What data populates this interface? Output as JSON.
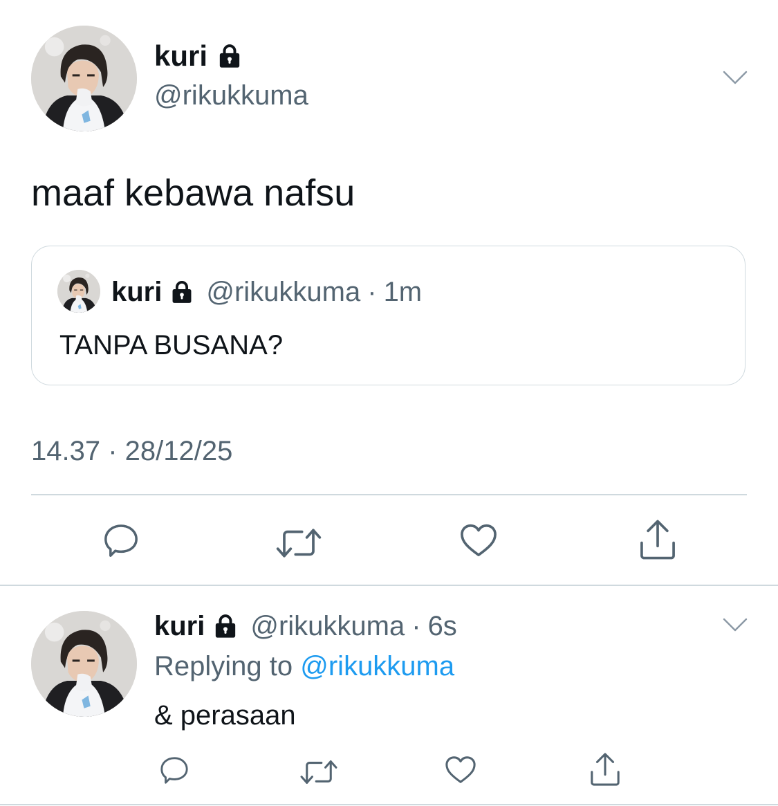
{
  "main_tweet": {
    "name": "kuri",
    "handle": "@rikukkuma",
    "text": "maaf kebawa nafsu",
    "timestamp": "14.37 · 28/12/25",
    "icons": {
      "lock": "lock-icon",
      "more": "chevron-down-icon",
      "reply": "reply-icon",
      "retweet": "retweet-icon",
      "like": "heart-icon",
      "share": "share-icon"
    }
  },
  "quote": {
    "name": "kuri",
    "handle": "@rikukkuma",
    "separator": "·",
    "time": "1m",
    "text": "TANPA BUSANA?"
  },
  "reply_tweet": {
    "name": "kuri",
    "handle": "@rikukkuma",
    "separator": "·",
    "time": "6s",
    "replying_prefix": "Replying to",
    "replying_to": "@rikukkuma",
    "text": "& perasaan"
  },
  "colors": {
    "text": "#0f1419",
    "secondary": "#536471",
    "link": "#1d9bf0",
    "border": "#cfd9de"
  }
}
